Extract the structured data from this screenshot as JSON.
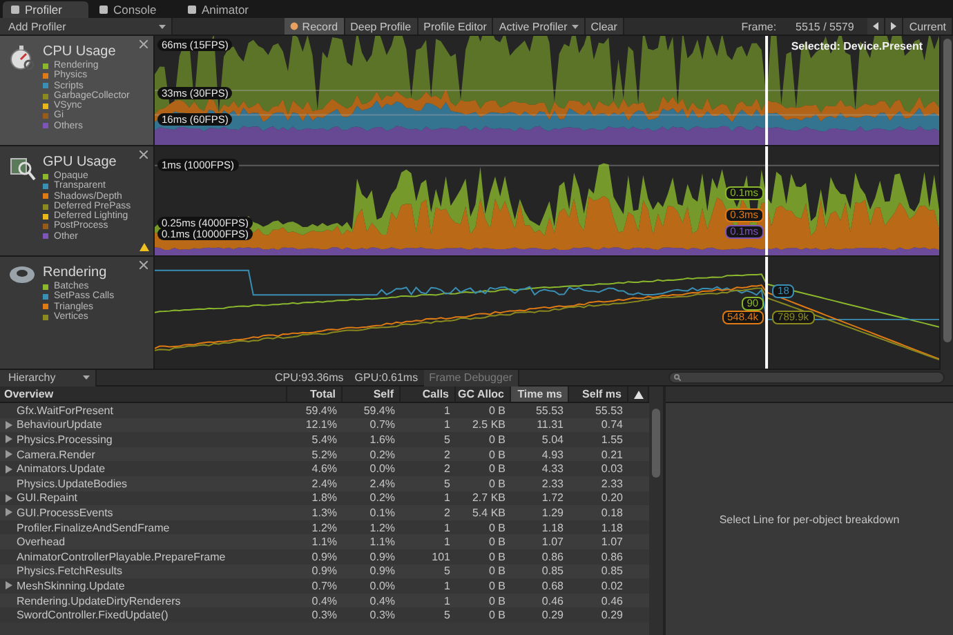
{
  "tabs": [
    {
      "label": "Profiler",
      "selected": true
    },
    {
      "label": "Console",
      "selected": false
    },
    {
      "label": "Animator",
      "selected": false
    }
  ],
  "toolbar": {
    "add_profiler": "Add Profiler",
    "buttons": [
      {
        "label": "Record",
        "kind": "record",
        "on": true
      },
      {
        "label": "Deep Profile",
        "kind": "toggle",
        "on": false
      },
      {
        "label": "Profile Editor",
        "kind": "toggle",
        "on": false
      },
      {
        "label": "Active Profiler",
        "kind": "dropdown"
      },
      {
        "label": "Clear",
        "kind": "toggle",
        "on": false
      }
    ],
    "frame_label": "Frame:",
    "frame_value": "5515 / 5579",
    "current": "Current"
  },
  "modules": [
    {
      "kind": "cpu",
      "title": "CPU Usage",
      "selected": true,
      "legend": [
        {
          "label": "Rendering",
          "color": "#8ab72c"
        },
        {
          "label": "Physics",
          "color": "#e07a14"
        },
        {
          "label": "Scripts",
          "color": "#3a8fb5"
        },
        {
          "label": "GarbageCollector",
          "color": "#8a8a1e"
        },
        {
          "label": "VSync",
          "color": "#e8b71c"
        },
        {
          "label": "Gi",
          "color": "#9b5a18"
        },
        {
          "label": "Others",
          "color": "#7d55b8"
        }
      ],
      "guides": [
        "66ms (15FPS)",
        "33ms (30FPS)",
        "16ms (60FPS)"
      ],
      "selected_label": "Selected: Device.Present"
    },
    {
      "kind": "gpu",
      "title": "GPU Usage",
      "selected": false,
      "warning": true,
      "legend": [
        {
          "label": "Opaque",
          "color": "#8ab72c"
        },
        {
          "label": "Transparent",
          "color": "#3a8fb5"
        },
        {
          "label": "Shadows/Depth",
          "color": "#e07a14"
        },
        {
          "label": "Deferred PrePass",
          "color": "#8a8a1e"
        },
        {
          "label": "Deferred Lighting",
          "color": "#e8b71c"
        },
        {
          "label": "PostProcess",
          "color": "#9b5a18"
        },
        {
          "label": "Other",
          "color": "#7d55b8"
        }
      ],
      "guides": [
        "1ms (1000FPS)",
        "0.25ms (4000FPS)",
        "0.1ms (10000FPS)"
      ],
      "cursor_labels": [
        {
          "text": "0.1ms",
          "color": "#8ab72c"
        },
        {
          "text": "0.3ms",
          "color": "#e07a14"
        },
        {
          "text": "0.1ms",
          "color": "#7d55b8"
        }
      ]
    },
    {
      "kind": "rendering",
      "title": "Rendering",
      "selected": false,
      "legend": [
        {
          "label": "Batches",
          "color": "#8ab72c"
        },
        {
          "label": "SetPass Calls",
          "color": "#3a8fb5"
        },
        {
          "label": "Triangles",
          "color": "#e07a14"
        },
        {
          "label": "Vertices",
          "color": "#8a8a1e"
        }
      ],
      "cursor_labels": [
        {
          "text": "18",
          "color": "#3a8fb5"
        },
        {
          "text": "90",
          "color": "#8ab72c"
        },
        {
          "text": "548.4k",
          "color": "#e07a14"
        },
        {
          "text": "789.9k",
          "color": "#8a8a1e"
        }
      ]
    }
  ],
  "lower_toolbar": {
    "view": "Hierarchy",
    "cpu": "CPU:93.36ms",
    "gpu": "GPU:0.61ms",
    "frame_debugger": "Frame Debugger"
  },
  "table": {
    "columns": [
      {
        "label": "Overview",
        "selected": false
      },
      {
        "label": "Total",
        "selected": false
      },
      {
        "label": "Self",
        "selected": false
      },
      {
        "label": "Calls",
        "selected": false
      },
      {
        "label": "GC Alloc",
        "selected": false
      },
      {
        "label": "Time ms",
        "selected": true
      },
      {
        "label": "Self ms",
        "selected": false
      }
    ],
    "rows": [
      {
        "kind": "leaf",
        "cells": [
          "Gfx.WaitForPresent",
          "59.4%",
          "59.4%",
          "1",
          "0 B",
          "55.53",
          "55.53"
        ]
      },
      {
        "kind": "group",
        "cells": [
          "BehaviourUpdate",
          "12.1%",
          "0.7%",
          "1",
          "2.5 KB",
          "11.31",
          "0.74"
        ]
      },
      {
        "kind": "group",
        "cells": [
          "Physics.Processing",
          "5.4%",
          "1.6%",
          "5",
          "0 B",
          "5.04",
          "1.55"
        ]
      },
      {
        "kind": "group",
        "cells": [
          "Camera.Render",
          "5.2%",
          "0.2%",
          "2",
          "0 B",
          "4.93",
          "0.21"
        ]
      },
      {
        "kind": "group",
        "cells": [
          "Animators.Update",
          "4.6%",
          "0.0%",
          "2",
          "0 B",
          "4.33",
          "0.03"
        ]
      },
      {
        "kind": "leaf",
        "cells": [
          "Physics.UpdateBodies",
          "2.4%",
          "2.4%",
          "5",
          "0 B",
          "2.33",
          "2.33"
        ]
      },
      {
        "kind": "group",
        "cells": [
          "GUI.Repaint",
          "1.8%",
          "0.2%",
          "1",
          "2.7 KB",
          "1.72",
          "0.20"
        ]
      },
      {
        "kind": "group",
        "cells": [
          "GUI.ProcessEvents",
          "1.3%",
          "0.1%",
          "2",
          "5.4 KB",
          "1.29",
          "0.18"
        ]
      },
      {
        "kind": "leaf",
        "cells": [
          "Profiler.FinalizeAndSendFrame",
          "1.2%",
          "1.2%",
          "1",
          "0 B",
          "1.18",
          "1.18"
        ]
      },
      {
        "kind": "leaf",
        "cells": [
          "Overhead",
          "1.1%",
          "1.1%",
          "1",
          "0 B",
          "1.07",
          "1.07"
        ]
      },
      {
        "kind": "leaf",
        "cells": [
          "AnimatorControllerPlayable.PrepareFrame",
          "0.9%",
          "0.9%",
          "101",
          "0 B",
          "0.86",
          "0.86"
        ]
      },
      {
        "kind": "leaf",
        "cells": [
          "Physics.FetchResults",
          "0.9%",
          "0.9%",
          "5",
          "0 B",
          "0.85",
          "0.85"
        ]
      },
      {
        "kind": "group",
        "cells": [
          "MeshSkinning.Update",
          "0.7%",
          "0.0%",
          "1",
          "0 B",
          "0.68",
          "0.02"
        ]
      },
      {
        "kind": "leaf",
        "cells": [
          "Rendering.UpdateDirtyRenderers",
          "0.4%",
          "0.4%",
          "1",
          "0 B",
          "0.46",
          "0.46"
        ]
      },
      {
        "kind": "leaf",
        "cells": [
          "SwordController.FixedUpdate()",
          "0.3%",
          "0.3%",
          "5",
          "0 B",
          "0.29",
          "0.29"
        ]
      }
    ]
  },
  "detail": {
    "message": "Select Line for per-object breakdown"
  }
}
